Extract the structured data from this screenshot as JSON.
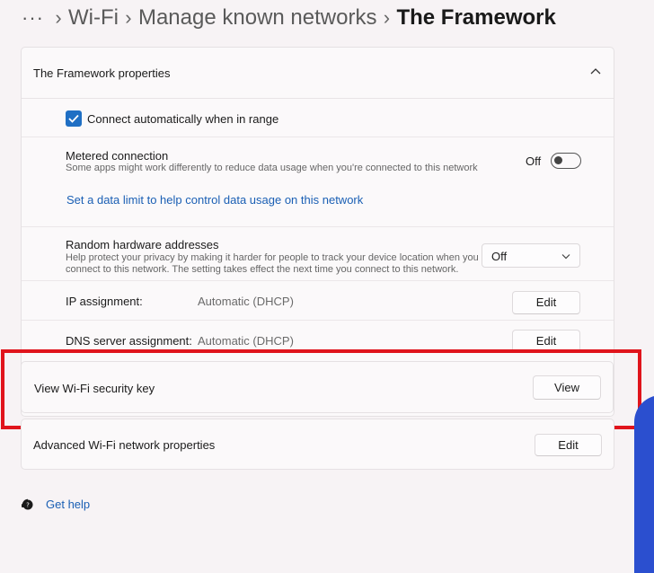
{
  "breadcrumb": {
    "more": "···",
    "items": [
      "Wi-Fi",
      "Manage known networks"
    ],
    "current": "The Framework"
  },
  "properties": {
    "title": "The Framework properties",
    "connect_auto": {
      "label": "Connect automatically when in range",
      "checked": true
    },
    "metered": {
      "label": "Metered connection",
      "description": "Some apps might work differently to reduce data usage when you're connected to this network",
      "state_label": "Off",
      "link": "Set a data limit to help control data usage on this network"
    },
    "random_hw": {
      "label": "Random hardware addresses",
      "description_1": "Help protect your privacy by making it harder for people to track your device location when you",
      "description_2": "connect to this network. The setting takes effect the next time you connect to this network.",
      "selected": "Off"
    },
    "ip": {
      "label": "IP assignment:",
      "value": "Automatic (DHCP)",
      "button": "Edit"
    },
    "dns": {
      "label": "DNS server assignment:",
      "value": "Automatic (DHCP)",
      "button": "Edit"
    }
  },
  "security_key": {
    "label": "View Wi-Fi security key",
    "button": "View"
  },
  "advanced": {
    "label": "Advanced Wi-Fi network properties",
    "button": "Edit"
  },
  "help": {
    "label": "Get help"
  },
  "colors": {
    "accent": "#1f6fc4",
    "highlight": "#e0141c",
    "link": "#1a5fb4"
  },
  "icons": [
    "chevron-right-icon",
    "chevron-up-icon",
    "checkmark-icon",
    "chevron-down-icon",
    "help-icon"
  ]
}
